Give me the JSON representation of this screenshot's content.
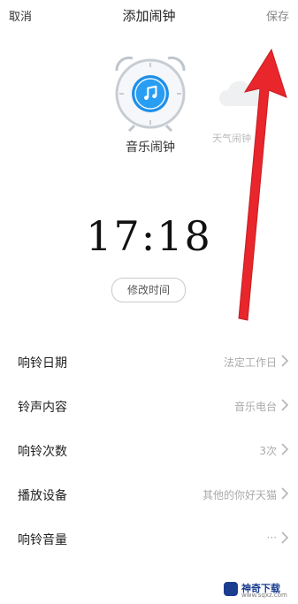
{
  "topbar": {
    "cancel_label": "取消",
    "title": "添加闹钟",
    "save_label": "保存"
  },
  "alarm_types": {
    "music": {
      "label": "音乐闹钟",
      "icon": "music-note-icon",
      "accent": "#1e8fe8"
    },
    "weather": {
      "label": "天气闹钟",
      "icon": "cloud-icon"
    }
  },
  "time": {
    "value": "17:18",
    "edit_label": "修改时间"
  },
  "settings": [
    {
      "label": "响铃日期",
      "value": "法定工作日"
    },
    {
      "label": "铃声内容",
      "value": "音乐电台"
    },
    {
      "label": "响铃次数",
      "value": "3次"
    },
    {
      "label": "播放设备",
      "value": "其他的你好天猫"
    },
    {
      "label": "响铃音量",
      "value": "···"
    }
  ],
  "annotation": {
    "color": "#e8262b"
  },
  "watermark": {
    "text": "神奇下载",
    "sub": "www.sqxz.com"
  }
}
